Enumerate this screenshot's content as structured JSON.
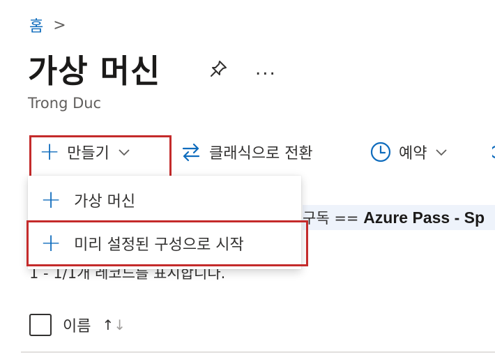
{
  "breadcrumb": {
    "home": "홈",
    "separator": ">"
  },
  "page": {
    "title": "가상 머신",
    "more": "...",
    "subtitle": "Trong Duc"
  },
  "toolbar": {
    "create_label": "만들기",
    "switch_label": "클래식으로 전환",
    "reserve_label": "예약"
  },
  "dropdown": {
    "items": [
      {
        "label": "가상 머신"
      },
      {
        "label": "미리 설정된 구성으로 시작"
      }
    ]
  },
  "filter": {
    "prefix": "구독 == ",
    "value": "Azure Pass - Sp"
  },
  "records": "1 - 1/1개 레코드를 표시합니다.",
  "table": {
    "col_name": "이름"
  },
  "colors": {
    "accent": "#0f6cbd",
    "highlight": "#c42b2b"
  }
}
